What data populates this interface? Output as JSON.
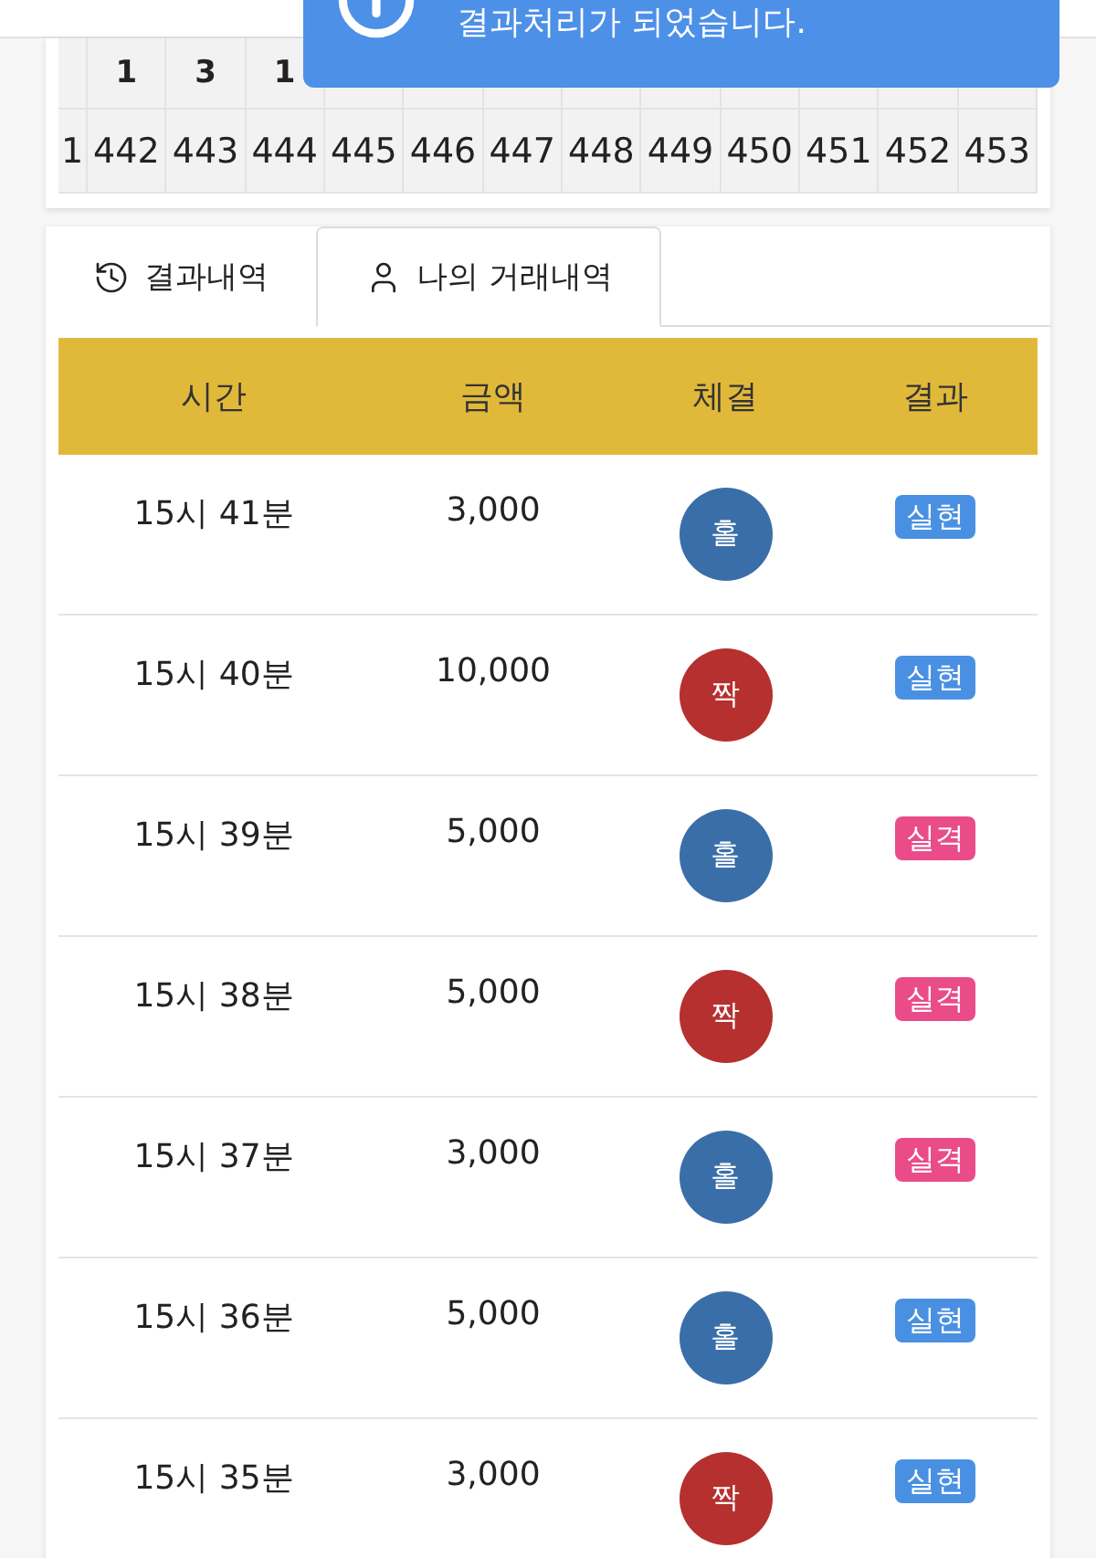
{
  "toast": {
    "message": "결과처리가 되었습니다."
  },
  "number_grid": {
    "top_row": [
      "1",
      "3",
      "1"
    ],
    "bottom_row": [
      "1",
      "442",
      "443",
      "444",
      "445",
      "446",
      "447",
      "448",
      "449",
      "450",
      "451",
      "452",
      "453"
    ]
  },
  "tabs": [
    {
      "label": "결과내역",
      "selected": false
    },
    {
      "label": "나의 거래내역",
      "selected": true
    }
  ],
  "table": {
    "columns": [
      "시간",
      "금액",
      "체결",
      "결과"
    ],
    "rows": [
      {
        "time": "15시 41분",
        "amount": "3,000",
        "pick": {
          "text": "홀",
          "color": "#3a6ea8"
        },
        "result": {
          "text": "실현",
          "color": "#4a90e2"
        }
      },
      {
        "time": "15시 40분",
        "amount": "10,000",
        "pick": {
          "text": "짝",
          "color": "#b5302e"
        },
        "result": {
          "text": "실현",
          "color": "#4a90e2"
        }
      },
      {
        "time": "15시 39분",
        "amount": "5,000",
        "pick": {
          "text": "홀",
          "color": "#3a6ea8"
        },
        "result": {
          "text": "실격",
          "color": "#ea4c89"
        }
      },
      {
        "time": "15시 38분",
        "amount": "5,000",
        "pick": {
          "text": "짝",
          "color": "#b5302e"
        },
        "result": {
          "text": "실격",
          "color": "#ea4c89"
        }
      },
      {
        "time": "15시 37분",
        "amount": "3,000",
        "pick": {
          "text": "홀",
          "color": "#3a6ea8"
        },
        "result": {
          "text": "실격",
          "color": "#ea4c89"
        }
      },
      {
        "time": "15시 36분",
        "amount": "5,000",
        "pick": {
          "text": "홀",
          "color": "#3a6ea8"
        },
        "result": {
          "text": "실현",
          "color": "#4a90e2"
        }
      },
      {
        "time": "15시 35분",
        "amount": "3,000",
        "pick": {
          "text": "짝",
          "color": "#b5302e"
        },
        "result": {
          "text": "실현",
          "color": "#4a90e2"
        }
      }
    ]
  }
}
